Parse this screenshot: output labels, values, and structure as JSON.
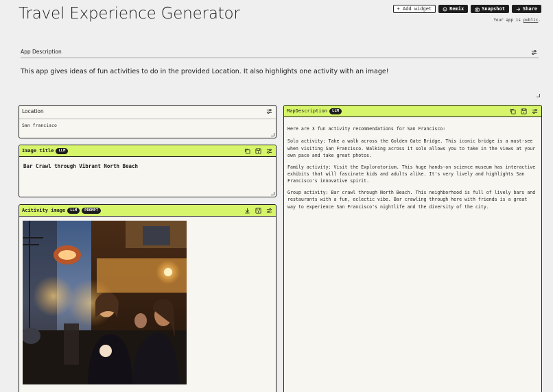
{
  "app": {
    "title": "Travel Experience Generator"
  },
  "toolbar": {
    "add_widget": "+ Add widget",
    "remix": "Remix",
    "snapshot": "Snapshot",
    "share": "Share",
    "public_prefix": "Your app is",
    "public_link": "public",
    "public_suffix": "."
  },
  "app_description": {
    "label": "App Description",
    "text": "This app gives ideas of fun activities to do in the provided Location. It also highlights one activity with an image!"
  },
  "location": {
    "label": "Location",
    "value": "San francisco"
  },
  "image_title": {
    "label": "Image title",
    "badge": "LLM",
    "value": "Bar Crawl through Vibrant North Beach"
  },
  "activity_image": {
    "label": "Acitivity image",
    "badges": [
      "LLM",
      "PROMPT"
    ]
  },
  "map_description": {
    "label": "MapDescription",
    "badge": "LLM",
    "paragraphs": [
      "Here are 3 fun activity recommendations for San Francisco:",
      "Solo activity: Take a walk across the Golden Gate Bridge. This iconic bridge is a must-see when visiting San Francisco. Walking across it solo allows you to take in the views at your own pace and take great photos.",
      "Family activity: Visit the Exploratorium. This huge hands-on science museum has interactive exhibits that will fascinate kids and adults alike. It's very lively and highlights San Francisco's innovative spirit.",
      "Group activity: Bar crawl through North Beach. This neighborhood is full of lively bars and restaurants with a fun, eclectic vibe. Bar crawling through here with friends is a great way to experience San Francisco's nightlife and the diversity of the city."
    ]
  },
  "colors": {
    "accent": "#d7f56a",
    "badge": "#1d1d1d",
    "background": "#efefef",
    "card": "#f7f6f1"
  },
  "icons": [
    "sliders-icon",
    "copy-icon",
    "save-icon",
    "download-icon",
    "camera-icon",
    "arrow-right-icon",
    "remix-icon"
  ]
}
